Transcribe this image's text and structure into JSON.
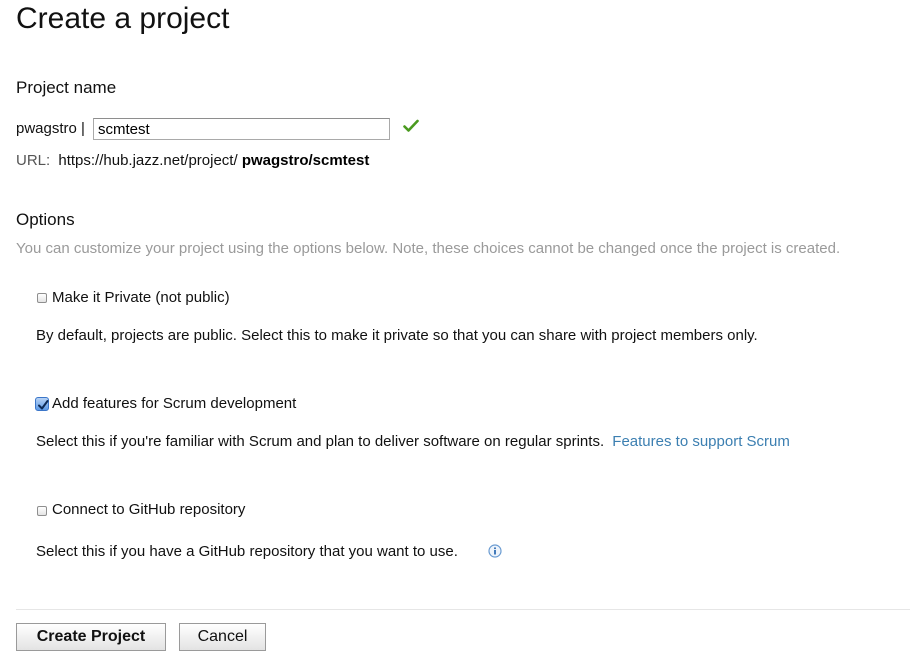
{
  "page_title": "Create a project",
  "project_name": {
    "heading": "Project name",
    "owner_prefix": "pwagstro |",
    "input_value": "scmtest",
    "valid_icon": "checkmark-icon",
    "url_label": "URL:",
    "url_base": "https://hub.jazz.net/project/",
    "url_slug": "pwagstro/scmtest"
  },
  "options": {
    "heading": "Options",
    "description": "You can customize your project using the options below. Note, these choices cannot be changed once the project is created.",
    "private": {
      "label": "Make it Private (not public)",
      "checked": false,
      "description": "By default, projects are public. Select this to make it private so that you can share with project members only."
    },
    "scrum": {
      "label": "Add features for Scrum development",
      "checked": true,
      "description": "Select this if you're familiar with Scrum and plan to deliver software on regular sprints.",
      "link": "Features to support Scrum"
    },
    "github": {
      "label": "Connect to GitHub repository",
      "checked": false,
      "description": "Select this if you have a GitHub repository that you want to use.",
      "info_icon": "info-icon"
    }
  },
  "actions": {
    "create_label": "Create Project",
    "cancel_label": "Cancel"
  },
  "colors": {
    "link": "#3c7fb1",
    "hint_text": "#9a9a9a",
    "valid_check": "#4a9a1f",
    "checkbox_checked": "#5d9ae6"
  }
}
